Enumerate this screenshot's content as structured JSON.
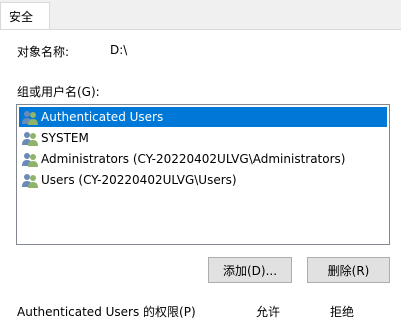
{
  "tab": {
    "label": "安全"
  },
  "object": {
    "label": "对象名称:",
    "value": "D:\\"
  },
  "groups": {
    "label": "组或用户名(G):",
    "items": [
      {
        "name": "Authenticated Users",
        "icon": "users-group-icon",
        "selected": true
      },
      {
        "name": "SYSTEM",
        "icon": "users-group-icon",
        "selected": false
      },
      {
        "name": "Administrators (CY-20220402ULVG\\Administrators)",
        "icon": "users-group-icon",
        "selected": false
      },
      {
        "name": "Users (CY-20220402ULVG\\Users)",
        "icon": "users-group-icon",
        "selected": false
      }
    ]
  },
  "buttons": {
    "add": "添加(D)...",
    "remove": "删除(R)"
  },
  "permissions": {
    "title": "Authenticated Users 的权限(P)",
    "allow": "允许",
    "deny": "拒绝"
  },
  "colors": {
    "selection": "#0078d7",
    "button_face": "#e1e1e1"
  }
}
